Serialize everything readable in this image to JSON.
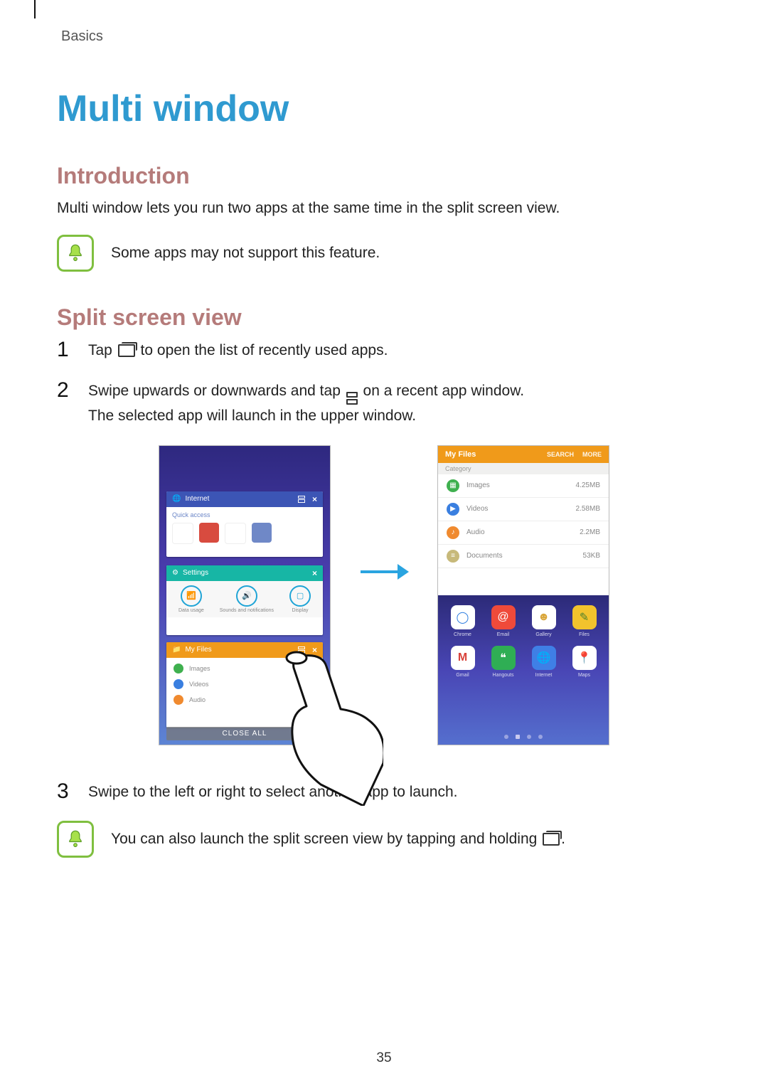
{
  "running_head": "Basics",
  "title": "Multi window",
  "sections": {
    "intro": {
      "heading": "Introduction",
      "body": "Multi window lets you run two apps at the same time in the split screen view.",
      "note": "Some apps may not support this feature."
    },
    "split": {
      "heading": "Split screen view",
      "steps": {
        "1": {
          "num": "1",
          "pre": "Tap ",
          "post": " to open the list of recently used apps."
        },
        "2": {
          "num": "2",
          "pre": "Swipe upwards or downwards and tap ",
          "post": " on a recent app window.",
          "line2": "The selected app will launch in the upper window."
        },
        "3": {
          "num": "3",
          "text": "Swipe to the left or right to select another app to launch."
        }
      },
      "note2_pre": "You can also launch the split screen view by tapping and holding ",
      "note2_post": "."
    }
  },
  "figure": {
    "left": {
      "cards": {
        "internet": {
          "title": "Internet",
          "quick": "Quick access"
        },
        "settings": {
          "title": "Settings",
          "items": [
            "Data usage",
            "Sounds and notifications",
            "Display"
          ]
        },
        "myfiles": {
          "title": "My Files",
          "cats": [
            "Images",
            "Videos",
            "Audio"
          ]
        }
      },
      "close_all": "CLOSE ALL"
    },
    "right": {
      "header": {
        "title": "My Files",
        "search": "SEARCH",
        "more": "MORE"
      },
      "subheader": "Category",
      "items": [
        {
          "label": "Images",
          "meta": "4.25MB",
          "color": "#3fb04f"
        },
        {
          "label": "Videos",
          "meta": "2.58MB",
          "color": "#3a7fe0"
        },
        {
          "label": "Audio",
          "meta": "2.2MB",
          "color": "#f08a2f"
        },
        {
          "label": "Documents",
          "meta": "53KB",
          "color": "#c7b97a"
        }
      ],
      "apps": [
        {
          "label": "Chrome",
          "bg": "#ffffff",
          "glyph": "◉",
          "fg": "#2f7ee0"
        },
        {
          "label": "Email",
          "bg": "#ef4a3a",
          "glyph": "@",
          "fg": "#ffffff"
        },
        {
          "label": "Gallery",
          "bg": "#ffffff",
          "glyph": "☺",
          "fg": "#d9a63a"
        },
        {
          "label": "Files",
          "bg": "#f2c32d",
          "glyph": "✎",
          "fg": "#4a7f2e"
        },
        {
          "label": "Gmail",
          "bg": "#ffffff",
          "glyph": "M",
          "fg": "#d8423a"
        },
        {
          "label": "Hangouts",
          "bg": "#2fae54",
          "glyph": "❝",
          "fg": "#ffffff"
        },
        {
          "label": "Internet",
          "bg": "#3f7fe6",
          "glyph": "🌐",
          "fg": "#ffffff"
        },
        {
          "label": "Maps",
          "bg": "#ffffff",
          "glyph": "📍",
          "fg": "#d8423a"
        }
      ]
    }
  },
  "page_number": "35"
}
